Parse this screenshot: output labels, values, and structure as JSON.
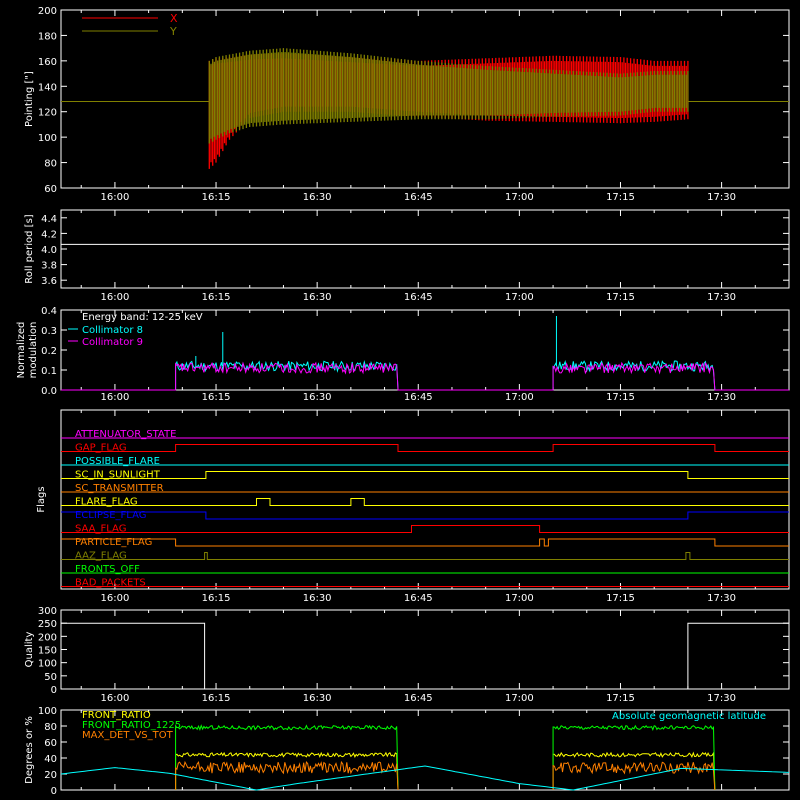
{
  "chart_data": [
    {
      "type": "line",
      "ylabel": "Pointing [\"]",
      "ylim": [
        60,
        200
      ],
      "yticks": [
        60,
        80,
        100,
        120,
        140,
        160,
        180,
        200
      ],
      "xticks": [
        "16:00",
        "16:15",
        "16:30",
        "16:45",
        "17:00",
        "17:15",
        "17:30"
      ],
      "xlim_minutes": [
        -8,
        100
      ],
      "legend": [
        {
          "name": "X",
          "color": "#ff0000"
        },
        {
          "name": "Y",
          "color": "#808000"
        }
      ],
      "series": [
        {
          "name": "X",
          "color": "#ff0000",
          "x": [
            14,
            15,
            17,
            20,
            25,
            35,
            45,
            55,
            65,
            75,
            80,
            85
          ],
          "upper": [
            160,
            162,
            163,
            165,
            166,
            163,
            160,
            162,
            164,
            163,
            160,
            160
          ],
          "lower": [
            75,
            80,
            98,
            115,
            120,
            120,
            116,
            113,
            112,
            111,
            112,
            114
          ]
        },
        {
          "name": "Y",
          "color": "#808000",
          "x": [
            14,
            15,
            17,
            20,
            25,
            35,
            45,
            55,
            65,
            75,
            80,
            85
          ],
          "upper": [
            160,
            163,
            165,
            168,
            170,
            166,
            160,
            156,
            153,
            150,
            152,
            152
          ],
          "lower": [
            95,
            98,
            103,
            108,
            110,
            112,
            114,
            114,
            116,
            117,
            120,
            120
          ],
          "baseline": 128
        }
      ]
    },
    {
      "type": "line",
      "ylabel": "Roll period [s]",
      "ylim": [
        3.5,
        4.5
      ],
      "yticks": [
        3.6,
        3.8,
        4.0,
        4.2,
        4.4
      ],
      "xticks": [
        "16:00",
        "16:15",
        "16:30",
        "16:45",
        "17:00",
        "17:15",
        "17:30"
      ],
      "series": [
        {
          "name": "",
          "color": "#ffffff",
          "x": [
            -8,
            100
          ],
          "y": [
            4.06,
            4.06
          ]
        }
      ]
    },
    {
      "type": "line",
      "ylabel": "Normalized modulation",
      "ylim": [
        0,
        0.4
      ],
      "yticks": [
        0.0,
        0.1,
        0.2,
        0.3,
        0.4
      ],
      "xticks": [
        "16:00",
        "16:15",
        "16:30",
        "16:45",
        "17:00",
        "17:15",
        "17:30"
      ],
      "annotations": [
        "Energy band: 12-25 keV"
      ],
      "legend": [
        {
          "name": "Collimator 8",
          "color": "#00ffff"
        },
        {
          "name": "Collimator 9",
          "color": "#ff00ff"
        }
      ],
      "series": [
        {
          "name": "Collimator 8",
          "color": "#00ffff",
          "segments": [
            [
              9,
              42
            ],
            [
              65,
              89
            ]
          ],
          "level": 0.12,
          "spikes": [
            [
              12,
              0.17
            ],
            [
              16,
              0.29
            ],
            [
              65.5,
              0.37
            ]
          ]
        },
        {
          "name": "Collimator 9",
          "color": "#ff00ff",
          "segments": [
            [
              9,
              42
            ],
            [
              65,
              89
            ]
          ],
          "level": 0.11
        }
      ]
    },
    {
      "type": "line",
      "ylabel": "Flags",
      "xticks": [
        "16:00",
        "16:15",
        "16:30",
        "16:45",
        "17:00",
        "17:15",
        "17:30"
      ],
      "flags": [
        {
          "name": "ATTENUATOR_STATE",
          "color": "#ff00ff",
          "transitions": []
        },
        {
          "name": "GAP_FLAG",
          "color": "#ff0000",
          "transitions": [
            [
              9,
              1
            ],
            [
              42,
              0
            ],
            [
              65,
              1
            ],
            [
              89,
              0
            ]
          ],
          "initial": 0
        },
        {
          "name": "POSSIBLE_FLARE",
          "color": "#00ffff",
          "transitions": []
        },
        {
          "name": "SC_IN_SUNLIGHT",
          "color": "#ffff00",
          "transitions": [
            [
              13.5,
              1
            ],
            [
              85,
              0
            ]
          ],
          "initial": 0
        },
        {
          "name": "SC_TRANSMITTER",
          "color": "#ff8000",
          "transitions": []
        },
        {
          "name": "FLARE_FLAG",
          "color": "#ffff00",
          "transitions": [
            [
              21,
              1
            ],
            [
              23,
              0
            ],
            [
              35,
              1
            ],
            [
              37,
              0
            ]
          ],
          "initial": 0
        },
        {
          "name": "ECLIPSE_FLAG",
          "color": "#0000ff",
          "transitions": [
            [
              13.5,
              0
            ],
            [
              85,
              1
            ]
          ],
          "initial": 1
        },
        {
          "name": "SAA_FLAG",
          "color": "#ff0000",
          "transitions": [
            [
              44,
              1
            ],
            [
              63,
              0
            ]
          ],
          "initial": 0
        },
        {
          "name": "PARTICLE_FLAG",
          "color": "#ff8000",
          "transitions": [
            [
              9,
              0
            ],
            [
              63,
              1
            ],
            [
              63.7,
              0
            ],
            [
              64.3,
              1
            ],
            [
              89,
              0
            ]
          ],
          "initial": 1
        },
        {
          "name": "AAZ_FLAG",
          "color": "#808000",
          "transitions": [
            [
              13.3,
              1
            ],
            [
              13.7,
              0
            ],
            [
              84.7,
              1
            ],
            [
              85.3,
              0
            ]
          ],
          "initial": 0
        },
        {
          "name": "FRONTS_OFF",
          "color": "#00ff00",
          "transitions": []
        },
        {
          "name": "BAD_PACKETS",
          "color": "#ff0000",
          "transitions": []
        }
      ]
    },
    {
      "type": "line",
      "ylabel": "Quality",
      "ylim": [
        0,
        300
      ],
      "yticks": [
        0,
        50,
        100,
        150,
        200,
        250,
        300
      ],
      "xticks": [
        "16:00",
        "16:15",
        "16:30",
        "16:45",
        "17:00",
        "17:15",
        "17:30"
      ],
      "series": [
        {
          "name": "",
          "color": "#ffffff",
          "x": [
            -8,
            13.3,
            13.3,
            85,
            85,
            100
          ],
          "y": [
            250,
            250,
            0,
            0,
            250,
            250
          ]
        }
      ]
    },
    {
      "type": "line",
      "ylabel": "Degrees or %",
      "ylim": [
        0,
        100
      ],
      "yticks": [
        0,
        20,
        40,
        60,
        80,
        100
      ],
      "xticks": [
        "16:00",
        "16:15",
        "16:30",
        "16:45",
        "17:00",
        "17:15",
        "17:30"
      ],
      "legend": [
        {
          "name": "FRONT_RATIO",
          "color": "#ffff00"
        },
        {
          "name": "FRONT_RATIO_1225",
          "color": "#00ff00"
        },
        {
          "name": "MAX_DET_VS_TOT",
          "color": "#ff8000"
        },
        {
          "name": "Absolute geomagnetic latitude",
          "color": "#00ffff"
        }
      ],
      "series": [
        {
          "name": "FRONT_RATIO",
          "color": "#ffff00",
          "segments": [
            [
              9,
              42
            ],
            [
              65,
              89
            ]
          ],
          "level": 44
        },
        {
          "name": "FRONT_RATIO_1225",
          "color": "#00ff00",
          "segments": [
            [
              9,
              42
            ],
            [
              65,
              89
            ]
          ],
          "level": 78
        },
        {
          "name": "MAX_DET_VS_TOT",
          "color": "#ff8000",
          "segments": [
            [
              9,
              42
            ],
            [
              65,
              89
            ]
          ],
          "level": 28
        },
        {
          "name": "Absolute geomagnetic latitude",
          "color": "#00ffff",
          "x": [
            -8,
            0,
            8,
            21,
            27,
            46,
            60,
            68,
            84,
            100
          ],
          "y": [
            20,
            28,
            21,
            0,
            8,
            30,
            8,
            0,
            27,
            22
          ]
        }
      ]
    }
  ]
}
